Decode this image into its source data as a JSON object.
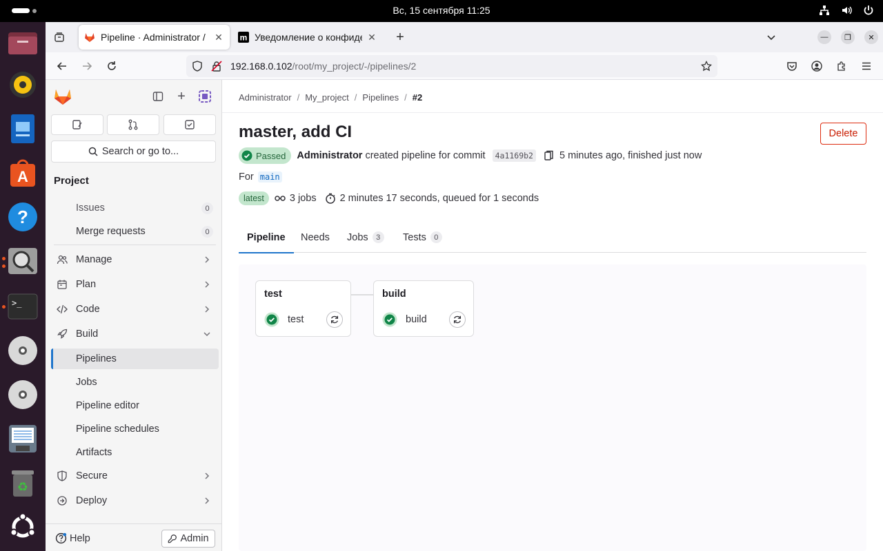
{
  "system": {
    "clock": "Вс, 15 сентября  11:25"
  },
  "dock": {
    "items": [
      {
        "name": "files-icon",
        "color": "#8a3b4e"
      },
      {
        "name": "rhythmbox-icon",
        "color": "#f5c211"
      },
      {
        "name": "writer-icon",
        "color": "#1e6bb8"
      },
      {
        "name": "app-center-icon",
        "color": "#e95420"
      },
      {
        "name": "help-icon",
        "color": "#1f8ce0"
      },
      {
        "name": "magnifier-icon",
        "color": "#bdbdbd"
      },
      {
        "name": "terminal-icon",
        "color": "#2c2c2c"
      },
      {
        "name": "disc-icon",
        "color": "#d0d0d0"
      },
      {
        "name": "disc-icon-2",
        "color": "#d0d0d0"
      },
      {
        "name": "text-editor-icon",
        "color": "#6a7b8c"
      },
      {
        "name": "trash-icon",
        "color": "#6b6b6b"
      },
      {
        "name": "ubuntu-icon",
        "color": "#ffffff"
      }
    ]
  },
  "browser": {
    "tabs": [
      {
        "title": "Pipeline · Administrator / ",
        "active": true
      },
      {
        "title": "Уведомление о конфиде",
        "active": false
      }
    ],
    "url_host": "192.168.0.102",
    "url_path": "/root/my_project/-/pipelines/2"
  },
  "sidebar": {
    "search_label": "Search or go to...",
    "project_heading": "Project",
    "items": [
      {
        "label": "Issues",
        "count": "0"
      },
      {
        "label": "Merge requests",
        "count": "0"
      },
      {
        "label": "Manage"
      },
      {
        "label": "Plan"
      },
      {
        "label": "Code"
      },
      {
        "label": "Build"
      },
      {
        "label": "Pipelines"
      },
      {
        "label": "Jobs"
      },
      {
        "label": "Pipeline editor"
      },
      {
        "label": "Pipeline schedules"
      },
      {
        "label": "Artifacts"
      },
      {
        "label": "Secure"
      },
      {
        "label": "Deploy"
      }
    ],
    "help_label": "Help",
    "admin_label": "Admin"
  },
  "breadcrumb": [
    "Administrator",
    "My_project",
    "Pipelines",
    "#2"
  ],
  "pipeline": {
    "title": "master, add CI",
    "delete_label": "Delete",
    "status": "Passed",
    "author": "Administrator",
    "created_text": " created pipeline for commit ",
    "sha": "4a1169b2",
    "time_text": "5 minutes ago, finished just now",
    "for_label": "For",
    "ref": "main",
    "latest_label": "latest",
    "jobs_text": "3 jobs",
    "duration_text": "2 minutes 17 seconds, queued for 1 seconds"
  },
  "tabs": [
    {
      "label": "Pipeline",
      "count": null
    },
    {
      "label": "Needs",
      "count": null
    },
    {
      "label": "Jobs",
      "count": "3"
    },
    {
      "label": "Tests",
      "count": "0"
    }
  ],
  "stages": [
    {
      "name": "test",
      "job": "test"
    },
    {
      "name": "build",
      "job": "build"
    }
  ],
  "colors": {
    "accent": "#1f75cb",
    "success": "#108548",
    "danger": "#dd2b0e"
  }
}
